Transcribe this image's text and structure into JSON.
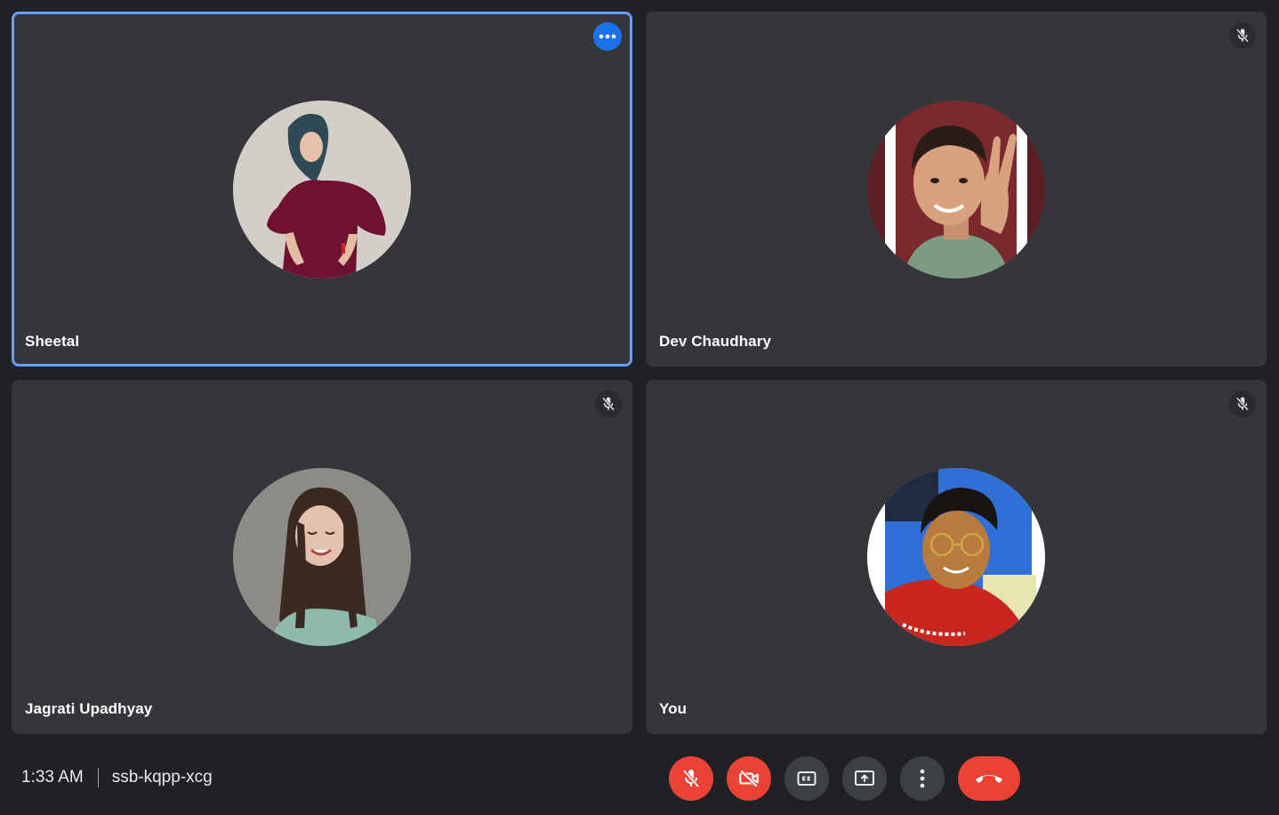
{
  "participants": [
    {
      "name": "Sheetal",
      "active": true,
      "badge": "more-options"
    },
    {
      "name": "Dev Chaudhary",
      "active": false,
      "badge": "mic-off"
    },
    {
      "name": "Jagrati Upadhyay",
      "active": false,
      "badge": "mic-off"
    },
    {
      "name": "You",
      "active": false,
      "badge": "mic-off"
    }
  ],
  "bottom_bar": {
    "time": "1:33 AM",
    "meeting_code": "ssb-kqpp-xcg",
    "controls": [
      {
        "icon": "mic-off-icon",
        "state": "off"
      },
      {
        "icon": "camera-off-icon",
        "state": "off"
      },
      {
        "icon": "captions-icon",
        "state": "off"
      },
      {
        "icon": "present-screen-icon",
        "state": "off"
      },
      {
        "icon": "more-vertical-icon",
        "state": "off"
      },
      {
        "icon": "hang-up-icon",
        "state": "end"
      }
    ]
  },
  "colors": {
    "background": "#202124",
    "tile": "#35363a",
    "active_border": "#669df6",
    "danger": "#ea4335",
    "accent": "#1a73e8"
  }
}
